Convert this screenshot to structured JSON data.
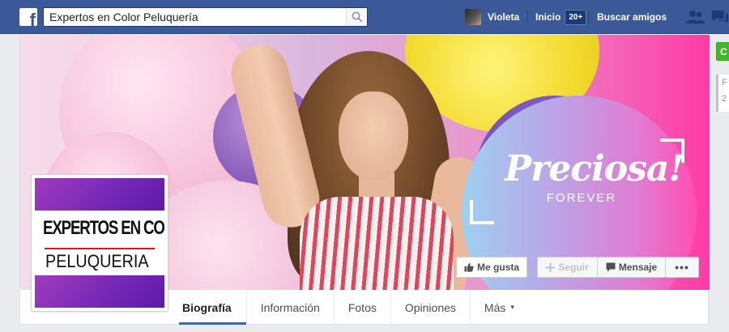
{
  "colors": {
    "brand_blue": "#3b5998",
    "accent": "#4267b2",
    "green": "#42b72a",
    "pink": "#ff3ba7"
  },
  "topbar": {
    "logo_icon": "facebook-f-icon",
    "search_value": "Expertos en Color Peluquería",
    "search_icon": "search-icon",
    "user_name": "Violeta",
    "home_label": "Inicio",
    "home_badge": "20+",
    "friends_label": "Buscar amigos",
    "friend_requests_icon": "friend-requests-icon",
    "messages_icon": "messages-icon"
  },
  "right_strip": {
    "green_button_text": "C",
    "box_lines": [
      "F",
      "2"
    ]
  },
  "cover": {
    "brand_script": "Preciosa!",
    "brand_sub": "FOREVER"
  },
  "actions": {
    "like_label": "Me gusta",
    "like_icon": "thumbs-up-icon",
    "follow_label": "Seguir",
    "follow_icon": "plus-icon",
    "message_label": "Mensaje",
    "message_icon": "speech-bubble-icon",
    "more_label": "•••"
  },
  "profile_picture": {
    "line1": "EXPERTOS EN COLOR",
    "line2": "PELUQUERIA"
  },
  "tabs": [
    {
      "label": "Biografía",
      "active": true
    },
    {
      "label": "Información"
    },
    {
      "label": "Fotos"
    },
    {
      "label": "Opiniones"
    },
    {
      "label": "Más",
      "caret": "▾"
    }
  ]
}
